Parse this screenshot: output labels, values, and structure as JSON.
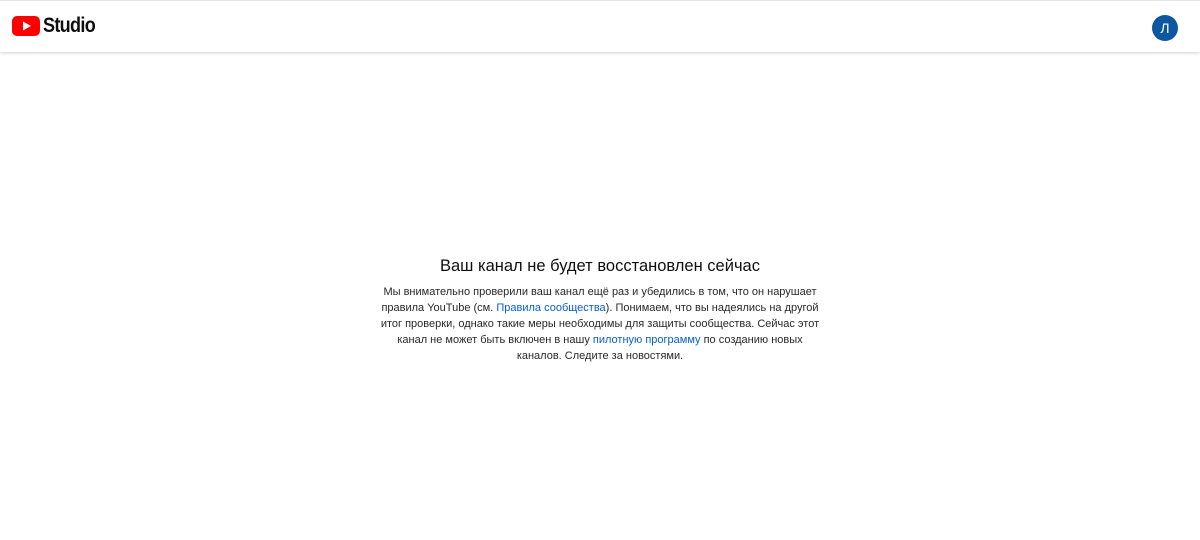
{
  "header": {
    "logo_text": "Studio",
    "avatar_letter": "Л"
  },
  "main": {
    "title": "Ваш канал не будет восстановлен сейчас",
    "message": {
      "part1": "Мы внимательно проверили ваш канал ещё раз и убедились в том, что он нарушает правила YouTube (см. ",
      "link1": "Правила сообщества",
      "part2": "). Понимаем, что вы надеялись на другой итог проверки, однако такие меры необходимы для защиты сообщества. Сейчас этот канал не может быть включен в нашу ",
      "link2": "пилотную программу",
      "part3": " по созданию новых каналов. Следите за новостями."
    }
  },
  "colors": {
    "brand_red": "#ff0000",
    "avatar_bg": "#0d57a0",
    "link": "#065fd4"
  }
}
